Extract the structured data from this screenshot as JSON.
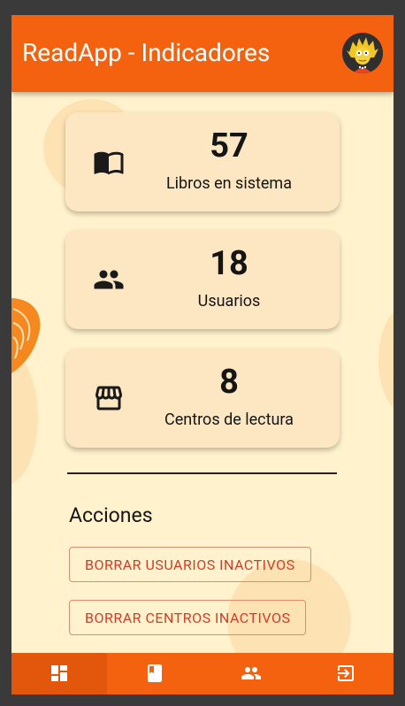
{
  "appbar": {
    "title": "ReadApp - Indicadores"
  },
  "stats": [
    {
      "value": "57",
      "label": "Libros en sistema",
      "icon": "book-icon"
    },
    {
      "value": "18",
      "label": "Usuarios",
      "icon": "people-icon"
    },
    {
      "value": "8",
      "label": "Centros de lectura",
      "icon": "store-icon"
    }
  ],
  "actions": {
    "title": "Acciones",
    "buttons": [
      {
        "label": "BORRAR USUARIOS INACTIVOS"
      },
      {
        "label": "BORRAR CENTROS INACTIVOS"
      }
    ]
  },
  "bottom_nav": [
    {
      "icon": "dashboard-icon",
      "active": true
    },
    {
      "icon": "book-icon",
      "active": false
    },
    {
      "icon": "people-icon",
      "active": false
    },
    {
      "icon": "logout-icon",
      "active": false
    }
  ],
  "colors": {
    "primary": "#f4620f",
    "background": "#fff2cc",
    "card": "#fde7c2",
    "action_text": "#d43c2a"
  }
}
